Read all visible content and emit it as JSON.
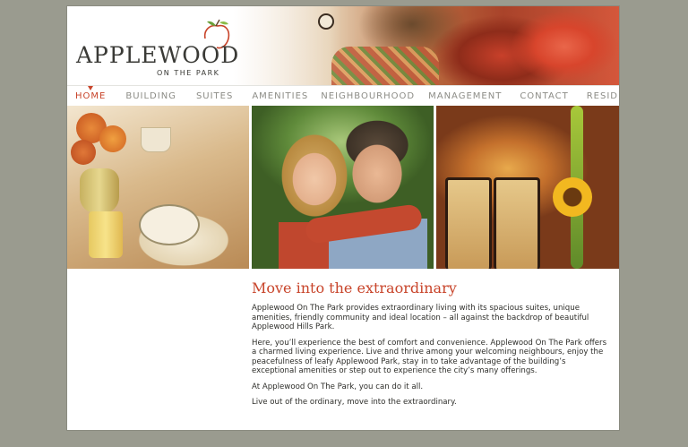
{
  "brand": {
    "name": "APPLEWOOD",
    "tagline": "ON THE PARK"
  },
  "nav": {
    "items": [
      {
        "label": "HOME",
        "active": true
      },
      {
        "label": "BUILDING",
        "active": false
      },
      {
        "label": "SUITES",
        "active": false
      },
      {
        "label": "AMENITIES",
        "active": false
      },
      {
        "label": "NEIGHBOURHOOD",
        "active": false
      },
      {
        "label": "MANAGEMENT",
        "active": false
      },
      {
        "label": "CONTACT",
        "active": false
      },
      {
        "label": "RESIDENT LOGIN",
        "active": false
      }
    ]
  },
  "main": {
    "headline": "Move into the extraordinary",
    "paragraphs": [
      "Applewood On The Park provides extraordinary living with its spacious suites, unique amenities, friendly community and ideal location – all against the backdrop of beautiful Applewood Hills Park.",
      "Here, you’ll experience the best of comfort and convenience. Applewood On The Park offers a charmed living experience. Live and thrive among your welcoming neighbours, enjoy the peacefulness of leafy Applewood Park, stay in to take advantage of the building’s exceptional amenities or step out to experience the city’s many offerings.",
      "At Applewood On The Park, you can do it all.",
      "Live out of the ordinary, move into the extraordinary."
    ]
  },
  "colors": {
    "accent": "#c8442a",
    "page_background": "#9a9b8f",
    "nav_text": "#8c8c86",
    "body_text": "#2e2e2a"
  }
}
